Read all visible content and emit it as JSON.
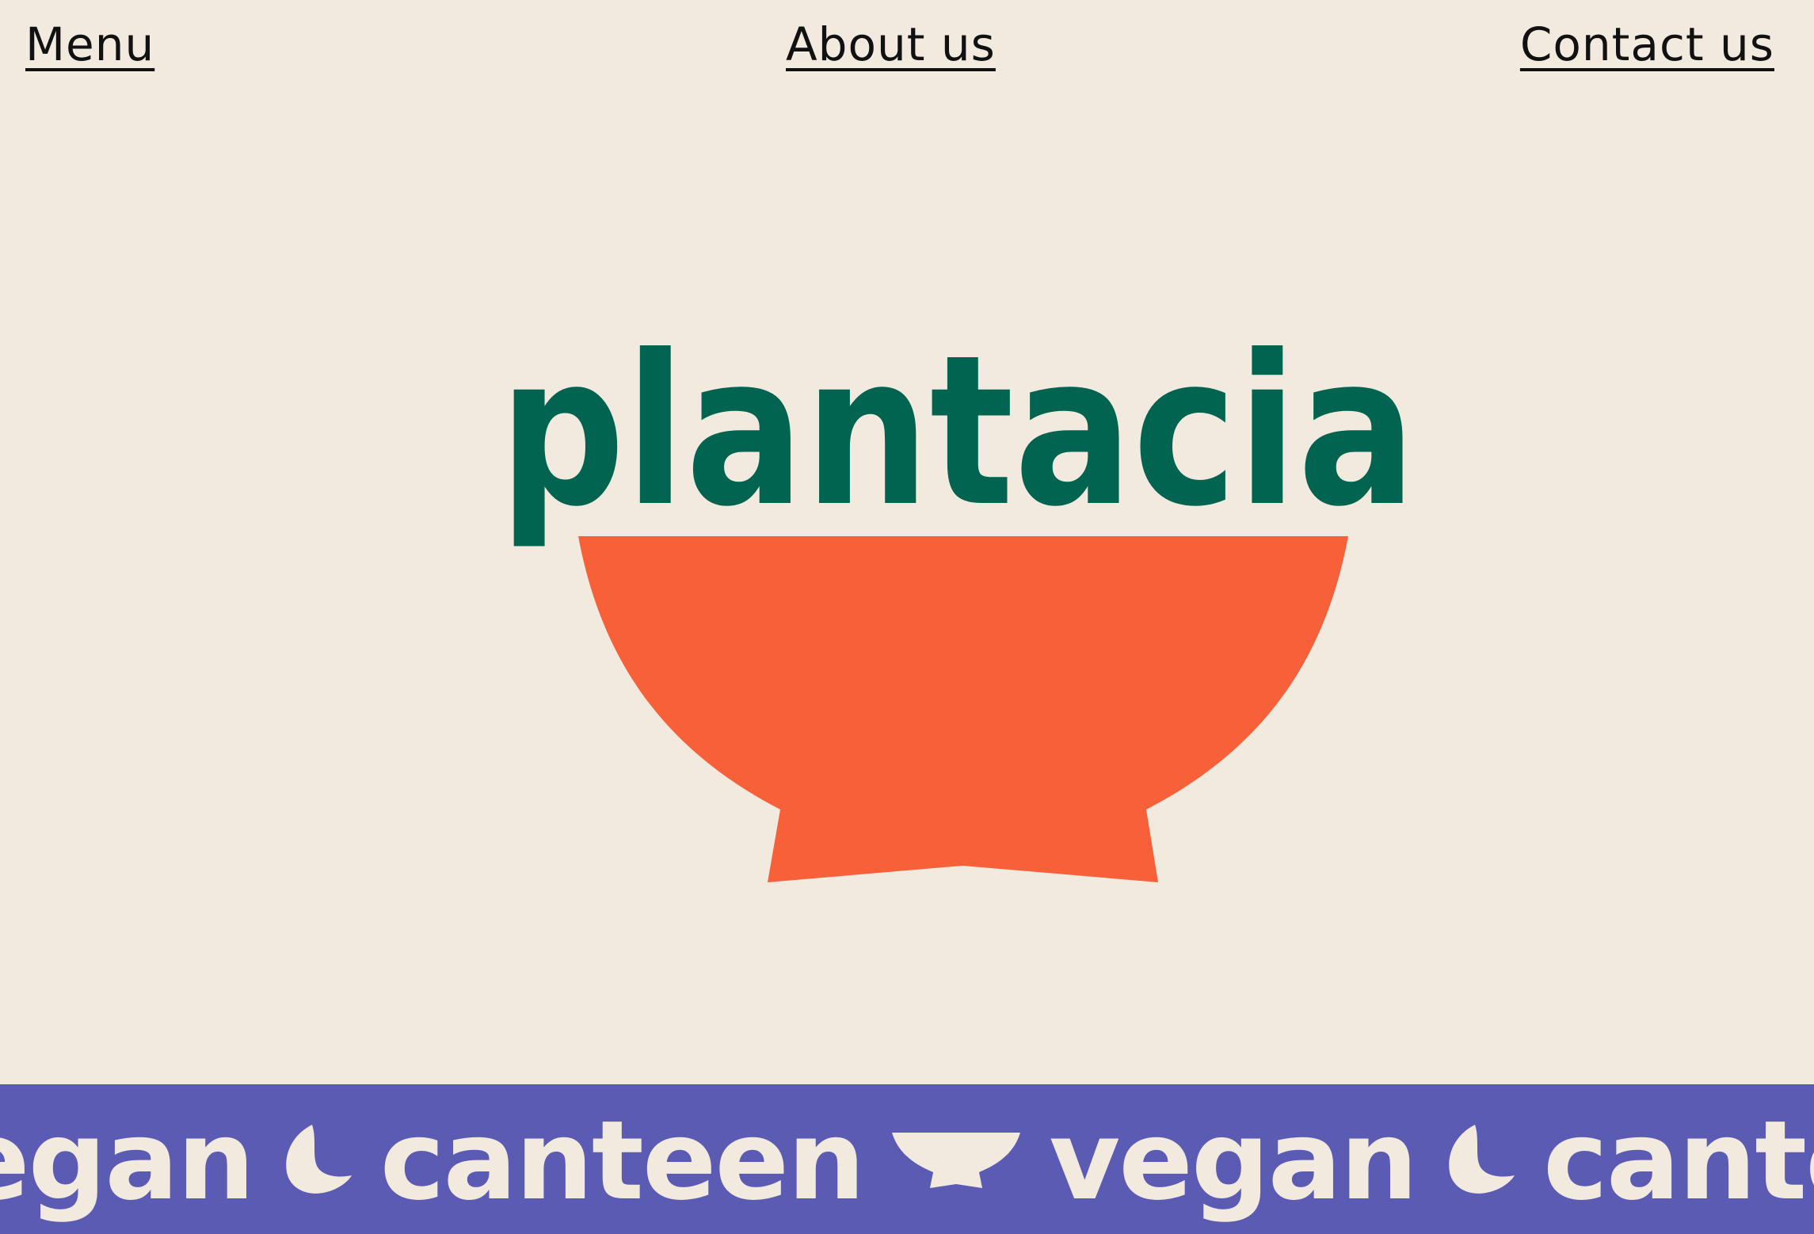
{
  "nav": {
    "menu_label": "Menu",
    "about_label": "About us",
    "contact_label": "Contact us"
  },
  "logo": {
    "wordmark": "plantacia",
    "wordmark_color": "#006450",
    "bowl_color": "#f76038",
    "icon": "bowl-icon"
  },
  "marquee": {
    "items": [
      "egan",
      "canteen",
      "vegan",
      "cantee"
    ],
    "background_color": "#5c5bb3",
    "text_color": "#f2eadf",
    "icons": [
      "leaf-icon",
      "bowl-icon",
      "leaf-icon"
    ]
  },
  "colors": {
    "background": "#f2eadf",
    "nav_text": "#111111"
  }
}
